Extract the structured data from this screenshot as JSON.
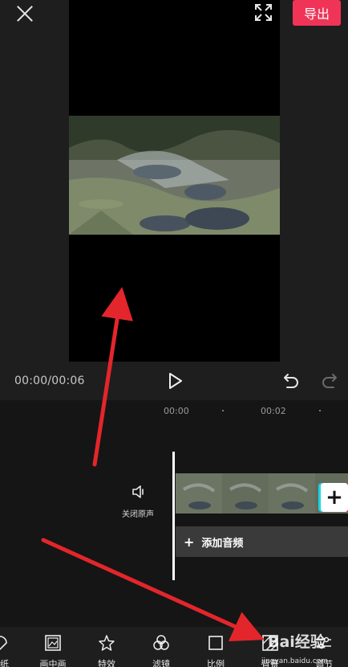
{
  "header": {
    "export_label": "导出",
    "close_icon": "close-icon",
    "fullscreen_icon": "fullscreen-icon"
  },
  "player": {
    "time_readout": "00:00/00:06",
    "play_icon": "play-icon",
    "undo_icon": "undo-icon",
    "redo_icon": "redo-icon"
  },
  "timeline": {
    "ticks": [
      "00:00",
      "00:02"
    ],
    "mute_label": "关闭原声",
    "add_clip_symbol": "+",
    "add_audio_plus": "+",
    "add_audio_label": "添加音频"
  },
  "toolbar": {
    "items": [
      {
        "label": "贴纸",
        "icon": "sticker-icon"
      },
      {
        "label": "画中画",
        "icon": "picture-in-picture-icon"
      },
      {
        "label": "特效",
        "icon": "effects-icon"
      },
      {
        "label": "滤镜",
        "icon": "filter-icon"
      },
      {
        "label": "比例",
        "icon": "ratio-icon"
      },
      {
        "label": "背景",
        "icon": "background-icon"
      },
      {
        "label": "调节",
        "icon": "adjust-icon"
      }
    ]
  },
  "watermark": {
    "brand": "Bai经验",
    "url": "jingyan.baidu.com"
  },
  "colors": {
    "accent": "#ef3458",
    "annotation_arrow": "#e3262b",
    "panel_dark": "#1e1e1e",
    "timeline_bg": "#151515"
  }
}
